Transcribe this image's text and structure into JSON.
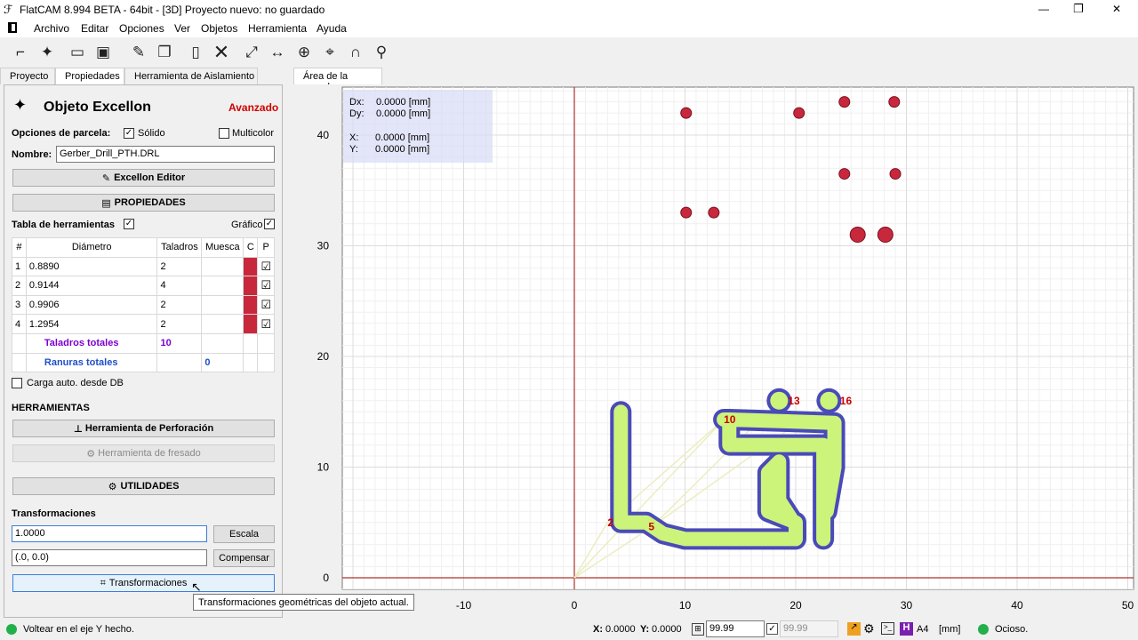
{
  "window": {
    "title": "FlatCAM 8.994 BETA - 64bit - [3D]   Proyecto nuevo: no guardado",
    "controls": [
      "—",
      "❐",
      "✕"
    ]
  },
  "menu": [
    "Archivo",
    "Editar",
    "Opciones",
    "Ver",
    "Objetos",
    "Herramienta",
    "Ayuda"
  ],
  "toolbar": {
    "icons": [
      "new-geometry-icon",
      "new-excellon-icon",
      "open-folder-icon",
      "save-icon",
      "edit-pencil-icon",
      "copy-doc-icon",
      "paste-icon",
      "delete-icon",
      "zoom-fit-icon",
      "distance-icon",
      "snap-grid-icon",
      "origin-icon",
      "magnet-icon",
      "pin-icon"
    ]
  },
  "left_tabs": [
    "Proyecto",
    "Propiedades",
    "Herramienta de Aislamiento"
  ],
  "plot_tab": "Área de la parcela",
  "panel": {
    "title": "Objeto Excellon",
    "level": "Avanzado",
    "plot_options_label": "Opciones de parcela:",
    "solid_label": "Sólido",
    "solid_checked": true,
    "multicolor_label": "Multicolor",
    "multicolor_checked": false,
    "name_label": "Nombre:",
    "name_value": "Gerber_Drill_PTH.DRL",
    "editor_button": "Excellon Editor",
    "properties_button": "PROPIEDADES",
    "tools_table_label": "Tabla de herramientas",
    "tools_table_checked": true,
    "plot_label": "Gráfico",
    "plot_checked": true,
    "table": {
      "headers": [
        "#",
        "Diámetro",
        "Taladros",
        "Muesca",
        "C",
        "P"
      ],
      "rows": [
        {
          "n": "1",
          "dia": "0.8890",
          "drills": "2",
          "slots": "",
          "color": "#c8283c",
          "plot": "☑"
        },
        {
          "n": "2",
          "dia": "0.9144",
          "drills": "4",
          "slots": "",
          "color": "#c8283c",
          "plot": "☑"
        },
        {
          "n": "3",
          "dia": "0.9906",
          "drills": "2",
          "slots": "",
          "color": "#c8283c",
          "plot": "☑"
        },
        {
          "n": "4",
          "dia": "1.2954",
          "drills": "2",
          "slots": "",
          "color": "#c8283c",
          "plot": "☑"
        }
      ],
      "total_drills_label": "Taladros totales",
      "total_drills": "10",
      "total_slots_label": "Ranuras totales",
      "total_slots": "0"
    },
    "autoload_label": "Carga auto. desde DB",
    "autoload_checked": false,
    "tools_section": "HERRAMIENTAS",
    "drill_tool_button": "Herramienta de Perforación",
    "mill_tool_button": "Herramienta de fresado",
    "utilities_button": "UTILIDADES",
    "transform_section": "Transformaciones",
    "scale_value": "1.0000",
    "scale_button": "Escala",
    "offset_value": "(.0, 0.0)",
    "offset_button": "Compensar",
    "transform_button": "Transformaciones",
    "tooltip": "Transformaciones geométricas del objeto actual."
  },
  "plot": {
    "readout": {
      "dx_label": "Dx:",
      "dx": "0.0000 [mm]",
      "dy_label": "Dy:",
      "dy": "0.0000 [mm]",
      "x_label": "X:",
      "x": "0.0000 [mm]",
      "y_label": "Y:",
      "y": "0.0000 [mm]"
    },
    "x_ticks": [
      "-10",
      "0",
      "10",
      "20",
      "30",
      "40",
      "50"
    ],
    "y_ticks": [
      "0",
      "10",
      "20",
      "30",
      "40"
    ],
    "drill_color": "#c8283c",
    "path_fill": "#ccf47a",
    "path_outline": "#4a4ab8",
    "path_labels": [
      "2",
      "5",
      "10",
      "13",
      "16"
    ]
  },
  "status": {
    "message": "Voltear en el eje Y hecho.",
    "x_label": "X:",
    "x": "0.0000",
    "y_label": "Y:",
    "y": "0.0000",
    "grid_value": "99.99",
    "grid_value2": "99.99",
    "sheet": "A4",
    "units": "[mm]",
    "state": "Ocioso."
  }
}
